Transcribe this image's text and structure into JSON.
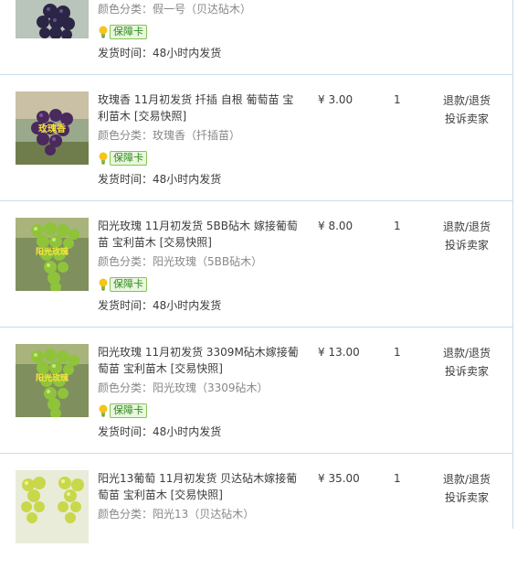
{
  "badge_label": "保障卡",
  "colors": {
    "border": "#c8dceb",
    "badge_text": "#2e8b1e",
    "badge_bg": "#eaf7df",
    "muted_text": "#888888"
  },
  "items": [
    {
      "title": "",
      "variant": "颜色分类：假一号（贝达砧木）",
      "shipping": "发货时间：48小时内发货",
      "price": "",
      "quantity": "",
      "refund_label": "",
      "complain_label": "",
      "image_icon": "dark-grape-photo",
      "image_text": ""
    },
    {
      "title": "玫瑰香 11月初发货 扦插 自根 葡萄苗 宝利苗木 [交易快照]",
      "variant": "颜色分类：玫瑰香（扦插苗）",
      "shipping": "发货时间：48小时内发货",
      "price": "¥ 3.00",
      "quantity": "1",
      "refund_label": "退款/退货",
      "complain_label": "投诉卖家",
      "image_icon": "purple-grape-photo",
      "image_text": "玫瑰香"
    },
    {
      "title": "阳光玫瑰 11月初发货 5BB砧木 嫁接葡萄苗 宝利苗木 [交易快照]",
      "variant": "颜色分类：阳光玫瑰（5BB砧木）",
      "shipping": "发货时间：48小时内发货",
      "price": "¥ 8.00",
      "quantity": "1",
      "refund_label": "退款/退货",
      "complain_label": "投诉卖家",
      "image_icon": "green-grape-photo",
      "image_text": "阳光玫瑰"
    },
    {
      "title": "阳光玫瑰 11月初发货 3309M砧木嫁接葡萄苗 宝利苗木 [交易快照]",
      "variant": "颜色分类：阳光玫瑰（3309砧木）",
      "shipping": "发货时间：48小时内发货",
      "price": "¥ 13.00",
      "quantity": "1",
      "refund_label": "退款/退货",
      "complain_label": "投诉卖家",
      "image_icon": "green-grape-photo",
      "image_text": "阳光玫瑰"
    },
    {
      "title": "阳光13葡萄 11月初发货 贝达砧木嫁接葡萄苗 宝利苗木 [交易快照]",
      "variant": "颜色分类：阳光13（贝达砧木）",
      "shipping": "",
      "price": "¥ 35.00",
      "quantity": "1",
      "refund_label": "退款/退货",
      "complain_label": "投诉卖家",
      "image_icon": "yellow-green-grape-photo",
      "image_text": ""
    }
  ]
}
